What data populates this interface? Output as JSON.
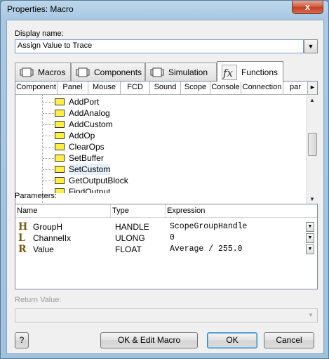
{
  "window": {
    "title": "Properties: Macro",
    "close_glyph": "x"
  },
  "display_name": {
    "label": "Display name:",
    "value": "Assign Value to Trace",
    "dropdown_glyph": "▼"
  },
  "tabs": [
    {
      "label": "Macros",
      "icon": "macros-icon"
    },
    {
      "label": "Components",
      "icon": "components-icon"
    },
    {
      "label": "Simulation",
      "icon": "simulation-icon"
    },
    {
      "label": "Functions",
      "icon": "functions-icon",
      "active": true
    }
  ],
  "subtabs": [
    "Component",
    "Panel",
    "Mouse",
    "FCD",
    "Sound",
    "Scope",
    "Console",
    "Connection",
    "par"
  ],
  "subtab_nav_glyph": "►",
  "functions": [
    {
      "label": "AddPort"
    },
    {
      "label": "AddAnalog"
    },
    {
      "label": "AddCustom"
    },
    {
      "label": "AddOp"
    },
    {
      "label": "ClearOps"
    },
    {
      "label": "SetBuffer"
    },
    {
      "label": "SetCustom",
      "selected": true
    },
    {
      "label": "GetOutputBlock"
    },
    {
      "label": "FindOutput"
    }
  ],
  "scroll_glyphs": {
    "up": "▲",
    "down": "▼"
  },
  "parameters": {
    "label": "Parameters:",
    "columns": [
      "Name",
      "Type",
      "Expression"
    ],
    "rows": [
      {
        "icon_letter": "H",
        "name": "GroupH",
        "type": "HANDLE",
        "expression": "ScopeGroupHandle"
      },
      {
        "icon_letter": "L",
        "name": "ChannelIx",
        "type": "ULONG",
        "expression": "0"
      },
      {
        "icon_letter": "R",
        "name": "Value",
        "type": "FLOAT",
        "expression": "Average / 255.0"
      }
    ],
    "row_dropdown_glyph": "▼"
  },
  "return_value": {
    "label": "Return Value:",
    "value": "",
    "dropdown_glyph": "▼"
  },
  "buttons": {
    "help": "?",
    "ok_edit": "OK & Edit Macro",
    "ok": "OK",
    "cancel": "Cancel"
  }
}
